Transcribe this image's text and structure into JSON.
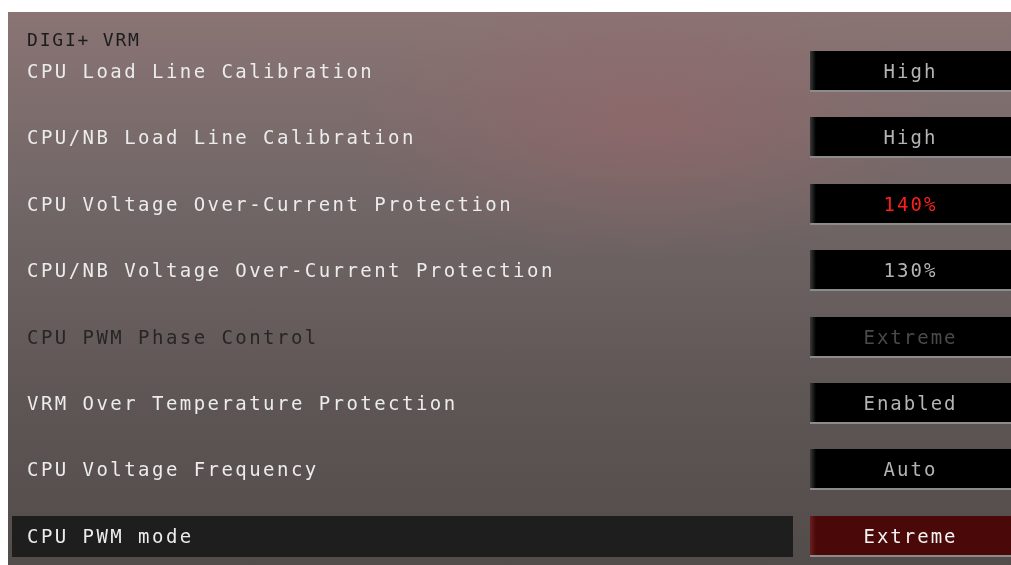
{
  "section": {
    "title": "DIGI+ VRM"
  },
  "settings": [
    {
      "label": "CPU Load Line Calibration",
      "value": "High",
      "selected": false,
      "disabled": false,
      "alert": false
    },
    {
      "label": "CPU/NB Load Line Calibration",
      "value": "High",
      "selected": false,
      "disabled": false,
      "alert": false
    },
    {
      "label": "CPU Voltage Over-Current Protection",
      "value": "140%",
      "selected": false,
      "disabled": false,
      "alert": true
    },
    {
      "label": "CPU/NB Voltage Over-Current Protection",
      "value": "130%",
      "selected": false,
      "disabled": false,
      "alert": false
    },
    {
      "label": "CPU PWM Phase Control",
      "value": "Extreme",
      "selected": false,
      "disabled": true,
      "alert": false
    },
    {
      "label": "VRM Over Temperature Protection",
      "value": "Enabled",
      "selected": false,
      "disabled": false,
      "alert": false
    },
    {
      "label": "CPU Voltage Frequency",
      "value": "Auto",
      "selected": false,
      "disabled": false,
      "alert": false
    },
    {
      "label": "CPU PWM mode",
      "value": "Extreme",
      "selected": true,
      "disabled": false,
      "alert": false
    }
  ]
}
